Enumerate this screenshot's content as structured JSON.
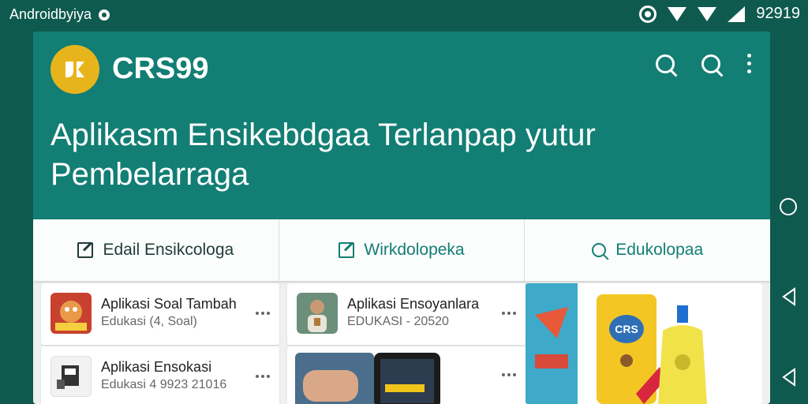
{
  "status_bar": {
    "app_label": "Androidbyiya",
    "time": "92919"
  },
  "app_bar": {
    "brand": "CRS99",
    "icons": [
      "search-icon",
      "search-icon",
      "more-vert-icon"
    ]
  },
  "hero": {
    "headline": "Aplikasm Ensikebdgaa Terlanpap yutur Pembelarraga"
  },
  "tabs": [
    {
      "label": "Edail Ensikcologa",
      "icon": "edit-icon"
    },
    {
      "label": "Wirkdolopeka",
      "icon": "edit-icon"
    },
    {
      "label": "Edukolopaa",
      "icon": "search-icon"
    }
  ],
  "list_left": [
    {
      "title": "Aplikasi Soal Tambah",
      "sub": "Edukasi (4, Soal)"
    },
    {
      "title": "Aplikasi Ensokasi",
      "sub": "Edukasi 4 9923 21016"
    }
  ],
  "list_mid": [
    {
      "title": "Aplikasi Ensoyanlara",
      "sub": "EDUKASI - 20520"
    }
  ],
  "product": {
    "label": "CRS"
  },
  "colors": {
    "primary": "#127e74",
    "background": "#0f5a4f",
    "accent": "#e8b41c"
  }
}
